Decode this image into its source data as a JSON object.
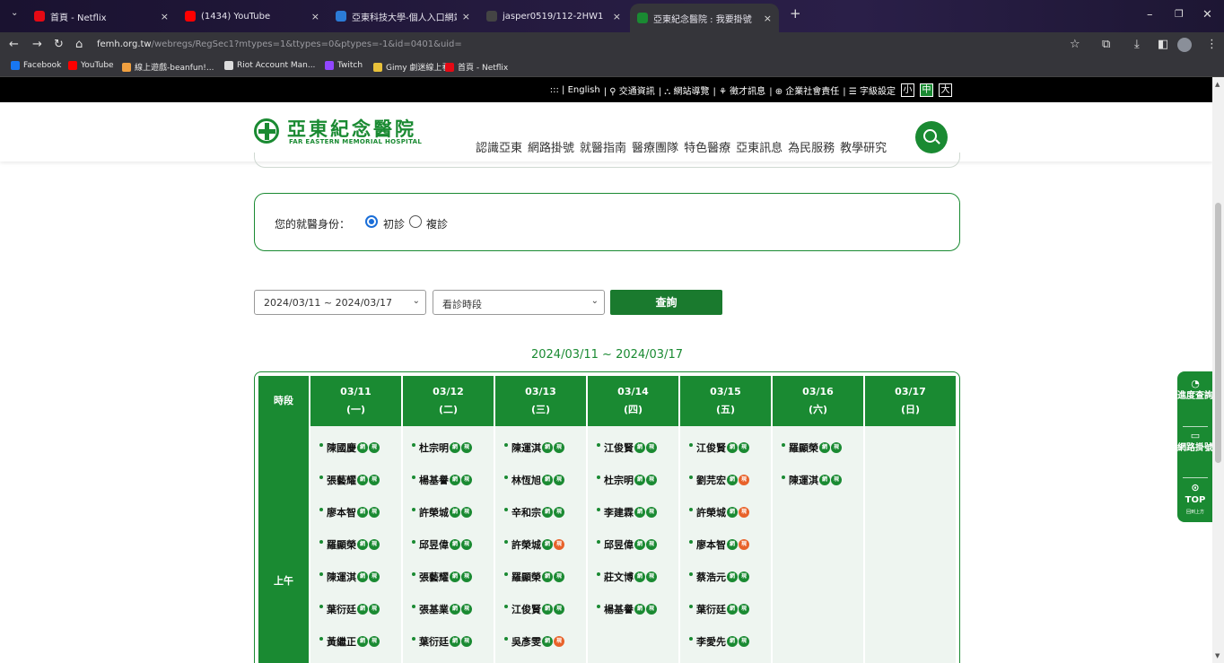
{
  "browser": {
    "tabs": [
      {
        "title": "首頁 - Netflix",
        "color": "#e50914"
      },
      {
        "title": "(1434) YouTube",
        "color": "#ff0000"
      },
      {
        "title": "亞東科技大學-個人入口網站",
        "color": "#2b7bd6"
      },
      {
        "title": "jasper0519/112-2HW1",
        "color": "#444444"
      },
      {
        "title": "亞東紀念醫院 : 我要掛號",
        "color": "#1a8a32"
      }
    ],
    "url_host": "femh.org.tw",
    "url_path": "/webregs/RegSec1?mtypes=1&ttypes=0&ptypes=-1&id=0401&uid=",
    "bookmarks": [
      {
        "label": "Facebook",
        "color": "#1877f2"
      },
      {
        "label": "YouTube",
        "color": "#ff0000"
      },
      {
        "label": "線上遊戲-beanfun!...",
        "color": "#f0a040"
      },
      {
        "label": "Riot Account Man...",
        "color": "#dddddd"
      },
      {
        "label": "Twitch",
        "color": "#9146ff"
      },
      {
        "label": "Gimy 劇迷線上看",
        "color": "#e8c13a"
      },
      {
        "label": "首頁 - Netflix",
        "color": "#e50914"
      }
    ]
  },
  "toplinks": {
    "items": [
      "::: | English",
      "| ⚲ 交通資訊",
      "| ⛬ 網站導覽",
      "| ⚘ 徵才訊息",
      "| ⊕ 企業社會責任",
      "| ☰ 字級設定"
    ],
    "sizes": [
      "小",
      "中",
      "大"
    ]
  },
  "logo": {
    "cn": "亞東紀念醫院",
    "en": "FAR EASTERN MEMORIAL HOSPITAL"
  },
  "nav": [
    "認識亞東",
    "網路掛號",
    "就醫指南",
    "醫療團隊",
    "特色醫療",
    "亞東訊息",
    "為民服務",
    "教學研究"
  ],
  "identity": {
    "label": "您的就醫身份：",
    "first": "初診",
    "return": "複診"
  },
  "filters": {
    "date_range": "2024/03/11 ~ 2024/03/17",
    "period": "看診時段",
    "query": "查詢"
  },
  "schedule": {
    "title": "2024/03/11 ~ 2024/03/17",
    "period_header": "時段",
    "period": "上午",
    "badge_net": "網",
    "badge_onsite": "現",
    "days": [
      {
        "date": "03/11",
        "dow": "(一)",
        "doctors": [
          [
            "陳國慶",
            0
          ],
          [
            "張藝耀",
            0
          ],
          [
            "廖本智",
            0
          ],
          [
            "羅顯榮",
            0
          ],
          [
            "陳運淇",
            0
          ],
          [
            "葉衍廷",
            0
          ],
          [
            "黃繼正",
            0
          ]
        ]
      },
      {
        "date": "03/12",
        "dow": "(二)",
        "doctors": [
          [
            "杜宗明",
            0
          ],
          [
            "楊基譽",
            0
          ],
          [
            "許榮城",
            0
          ],
          [
            "邱昱偉",
            0
          ],
          [
            "張藝耀",
            0
          ],
          [
            "張基業",
            0
          ],
          [
            "葉衍廷",
            0
          ]
        ]
      },
      {
        "date": "03/13",
        "dow": "(三)",
        "doctors": [
          [
            "陳運淇",
            0
          ],
          [
            "林恆旭",
            0
          ],
          [
            "辛和宗",
            0
          ],
          [
            "許榮城",
            1
          ],
          [
            "羅顯榮",
            0
          ],
          [
            "江俊賢",
            0
          ],
          [
            "吳彥雯",
            1
          ]
        ]
      },
      {
        "date": "03/14",
        "dow": "(四)",
        "doctors": [
          [
            "江俊賢",
            0
          ],
          [
            "杜宗明",
            0
          ],
          [
            "李建霖",
            0
          ],
          [
            "邱昱偉",
            0
          ],
          [
            "莊文博",
            0
          ],
          [
            "楊基譽",
            0
          ]
        ]
      },
      {
        "date": "03/15",
        "dow": "(五)",
        "doctors": [
          [
            "江俊賢",
            0
          ],
          [
            "劉芫宏",
            1
          ],
          [
            "許榮城",
            1
          ],
          [
            "廖本智",
            1
          ],
          [
            "蔡浩元",
            0
          ],
          [
            "葉衍廷",
            0
          ],
          [
            "李愛先",
            0
          ]
        ]
      },
      {
        "date": "03/16",
        "dow": "(六)",
        "doctors": [
          [
            "羅顯榮",
            0
          ],
          [
            "陳運淇",
            0
          ]
        ]
      },
      {
        "date": "03/17",
        "dow": "(日)",
        "doctors": []
      }
    ]
  },
  "sidebar": {
    "progress": "進度查詢",
    "register": "網路掛號",
    "top": "TOP",
    "top_sub": "回到上方"
  }
}
